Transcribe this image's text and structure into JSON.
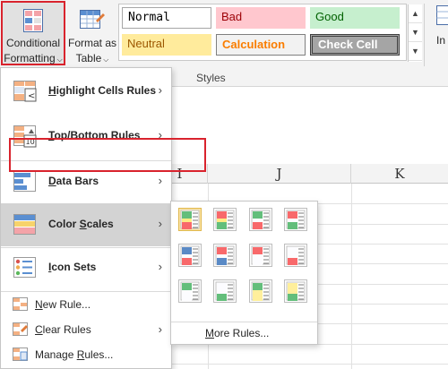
{
  "ribbon": {
    "conditional_formatting": {
      "line1": "Conditional",
      "line2": "Formatting"
    },
    "format_as_table": {
      "line1": "Format as",
      "line2": "Table"
    },
    "styles_group_label": "Styles",
    "insert_partial": "In",
    "styles": [
      {
        "name": "Normal"
      },
      {
        "name": "Bad"
      },
      {
        "name": "Good"
      },
      {
        "name": "Neutral"
      },
      {
        "name": "Calculation"
      },
      {
        "name": "Check Cell"
      }
    ]
  },
  "sheet": {
    "columns": [
      "I",
      "J",
      "K"
    ]
  },
  "menu": {
    "items": [
      {
        "pre": "",
        "u": "H",
        "post": "ighlight Cells Rules",
        "icon": "highlight-cells-icon"
      },
      {
        "pre": "",
        "u": "T",
        "post": "op/Bottom Rules",
        "icon": "top-bottom-icon"
      },
      {
        "pre": "",
        "u": "D",
        "post": "ata Bars",
        "icon": "data-bars-icon"
      },
      {
        "pre": "Color ",
        "u": "S",
        "post": "cales",
        "icon": "color-scales-icon"
      },
      {
        "pre": "",
        "u": "I",
        "post": "con Sets",
        "icon": "icon-sets-icon"
      }
    ],
    "small_items": [
      {
        "pre": "",
        "u": "N",
        "post": "ew Rule...",
        "icon": "new-rule-icon"
      },
      {
        "pre": "",
        "u": "C",
        "post": "lear Rules",
        "icon": "clear-rules-icon"
      },
      {
        "pre": "Manage ",
        "u": "R",
        "post": "ules...",
        "icon": "manage-rules-icon"
      }
    ]
  },
  "submenu": {
    "more_rules": {
      "pre": "",
      "u": "M",
      "post": "ore Rules..."
    },
    "scales": [
      {
        "colors": [
          "#63be7b",
          "#ffeb84",
          "#f8696b"
        ]
      },
      {
        "colors": [
          "#f8696b",
          "#ffeb84",
          "#63be7b"
        ]
      },
      {
        "colors": [
          "#63be7b",
          "#fcfcff",
          "#f8696b"
        ]
      },
      {
        "colors": [
          "#f8696b",
          "#fcfcff",
          "#63be7b"
        ]
      },
      {
        "colors": [
          "#5a8ac6",
          "#fcfcff",
          "#f8696b"
        ]
      },
      {
        "colors": [
          "#f8696b",
          "#fcfcff",
          "#5a8ac6"
        ]
      },
      {
        "colors": [
          "#f8696b",
          "#fcfcff",
          "#fcfcff"
        ]
      },
      {
        "colors": [
          "#fcfcff",
          "#fcfcff",
          "#f8696b"
        ]
      },
      {
        "colors": [
          "#63be7b",
          "#fcfcff",
          "#fcfcff"
        ]
      },
      {
        "colors": [
          "#fcfcff",
          "#fcfcff",
          "#63be7b"
        ]
      },
      {
        "colors": [
          "#63be7b",
          "#ffef9c",
          "#ffef9c"
        ]
      },
      {
        "colors": [
          "#ffef9c",
          "#ffef9c",
          "#63be7b"
        ]
      }
    ]
  }
}
